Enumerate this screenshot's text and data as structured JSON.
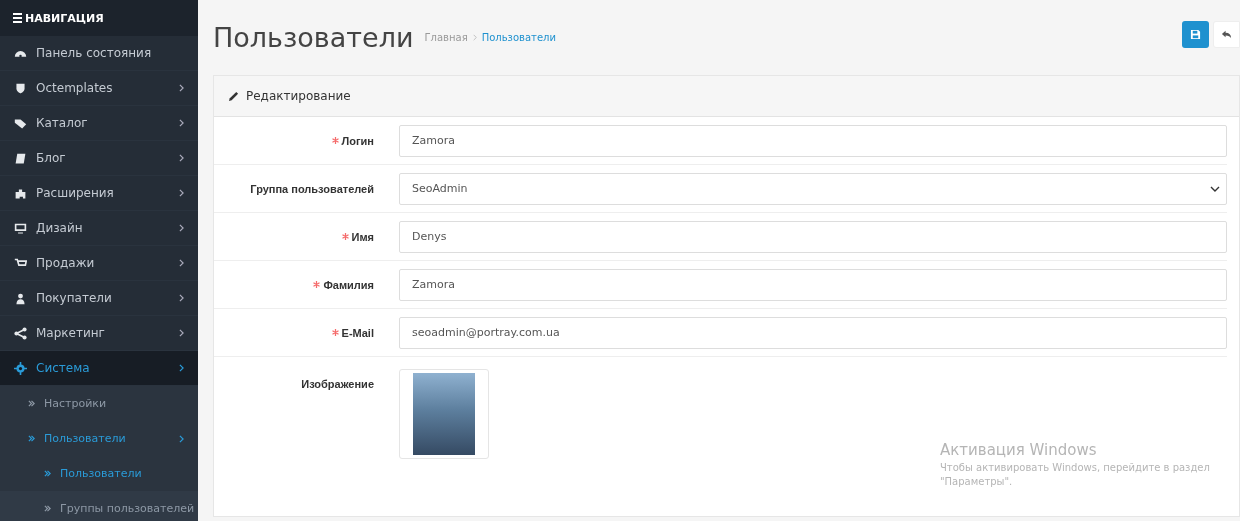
{
  "sidebar": {
    "heading": "НАВИГАЦИЯ",
    "items": [
      {
        "label": "Панель состояния",
        "has_arrow": false,
        "selected": false
      },
      {
        "label": "Octemplates",
        "has_arrow": true,
        "selected": false
      },
      {
        "label": "Каталог",
        "has_arrow": true,
        "selected": false
      },
      {
        "label": "Блог",
        "has_arrow": true,
        "selected": false
      },
      {
        "label": "Расширения",
        "has_arrow": true,
        "selected": false
      },
      {
        "label": "Дизайн",
        "has_arrow": true,
        "selected": false
      },
      {
        "label": "Продажи",
        "has_arrow": true,
        "selected": false
      },
      {
        "label": "Покупатели",
        "has_arrow": true,
        "selected": false
      },
      {
        "label": "Маркетинг",
        "has_arrow": true,
        "selected": false
      },
      {
        "label": "Система",
        "has_arrow": true,
        "selected": true,
        "expanded": true,
        "children": [
          {
            "label": "Настройки",
            "has_arrow": false,
            "selected": false
          },
          {
            "label": "Пользователи",
            "has_arrow": true,
            "selected": true,
            "expanded": true,
            "children": [
              {
                "label": "Пользователи",
                "selected": true
              },
              {
                "label": "Группы пользователей",
                "selected": false
              }
            ]
          }
        ]
      }
    ]
  },
  "page": {
    "title": "Пользователи",
    "breadcrumbs": [
      {
        "label": "Главная",
        "selected": false
      },
      {
        "label": "Пользователи",
        "selected": true
      }
    ]
  },
  "panel": {
    "title": "Редактирование",
    "fields": [
      {
        "kind": "input",
        "label": "Логин",
        "required": true,
        "value": "Zamora"
      },
      {
        "kind": "select",
        "label": "Группа пользователей",
        "required": false,
        "value": "SeoAdmin"
      },
      {
        "kind": "input",
        "label": "Имя",
        "required": true,
        "value": "Denys"
      },
      {
        "kind": "input",
        "label": "Фамилия",
        "required": true,
        "value": "Zamora"
      },
      {
        "kind": "input",
        "label": "E-Mail",
        "required": true,
        "value": "seoadmin@portray.com.ua"
      },
      {
        "kind": "image",
        "label": "Изображение",
        "required": false
      }
    ]
  },
  "activation": {
    "title": "Активация Windows",
    "text": "Чтобы активировать Windows, перейдите в раздел \"Параметры\"."
  }
}
